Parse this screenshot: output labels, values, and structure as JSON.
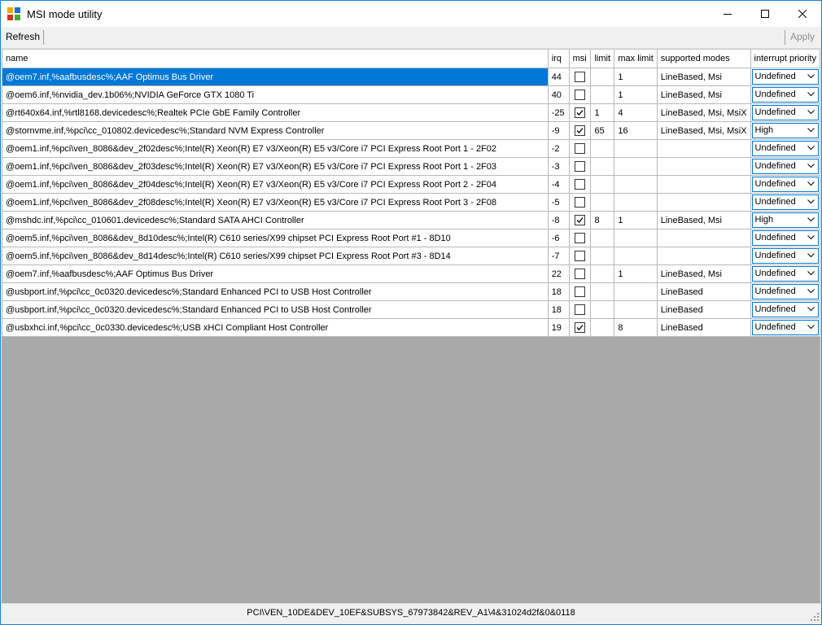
{
  "window": {
    "title": "MSI mode utility"
  },
  "toolbar": {
    "refresh_label": "Refresh",
    "apply_label": "Apply"
  },
  "columns": [
    "name",
    "irq",
    "msi",
    "limit",
    "max limit",
    "supported modes",
    "interrupt priority"
  ],
  "rows": [
    {
      "name": "@oem7.inf,%aafbusdesc%;AAF Optimus Bus Driver",
      "irq": "44",
      "msi": false,
      "limit": "",
      "max_limit": "1",
      "modes": "LineBased, Msi",
      "priority": "Undefined"
    },
    {
      "name": "@oem6.inf,%nvidia_dev.1b06%;NVIDIA GeForce GTX 1080 Ti",
      "irq": "40",
      "msi": false,
      "limit": "",
      "max_limit": "1",
      "modes": "LineBased, Msi",
      "priority": "Undefined"
    },
    {
      "name": "@rt640x64.inf,%rtl8168.devicedesc%;Realtek PCIe GbE Family Controller",
      "irq": "-25",
      "msi": true,
      "limit": "1",
      "max_limit": "4",
      "modes": "LineBased, Msi, MsiX",
      "priority": "Undefined"
    },
    {
      "name": "@stornvme.inf,%pci\\cc_010802.devicedesc%;Standard NVM Express Controller",
      "irq": "-9",
      "msi": true,
      "limit": "65",
      "max_limit": "16",
      "modes": "LineBased, Msi, MsiX",
      "priority": "High"
    },
    {
      "name": "@oem1.inf,%pci\\ven_8086&dev_2f02desc%;Intel(R) Xeon(R) E7 v3/Xeon(R) E5 v3/Core i7 PCI Express Root Port 1 - 2F02",
      "irq": "-2",
      "msi": false,
      "limit": "",
      "max_limit": "",
      "modes": "",
      "priority": "Undefined"
    },
    {
      "name": "@oem1.inf,%pci\\ven_8086&dev_2f03desc%;Intel(R) Xeon(R) E7 v3/Xeon(R) E5 v3/Core i7 PCI Express Root Port 1 - 2F03",
      "irq": "-3",
      "msi": false,
      "limit": "",
      "max_limit": "",
      "modes": "",
      "priority": "Undefined"
    },
    {
      "name": "@oem1.inf,%pci\\ven_8086&dev_2f04desc%;Intel(R) Xeon(R) E7 v3/Xeon(R) E5 v3/Core i7 PCI Express Root Port 2 - 2F04",
      "irq": "-4",
      "msi": false,
      "limit": "",
      "max_limit": "",
      "modes": "",
      "priority": "Undefined"
    },
    {
      "name": "@oem1.inf,%pci\\ven_8086&dev_2f08desc%;Intel(R) Xeon(R) E7 v3/Xeon(R) E5 v3/Core i7 PCI Express Root Port 3 - 2F08",
      "irq": "-5",
      "msi": false,
      "limit": "",
      "max_limit": "",
      "modes": "",
      "priority": "Undefined"
    },
    {
      "name": "@mshdc.inf,%pci\\cc_010601.devicedesc%;Standard SATA AHCI Controller",
      "irq": "-8",
      "msi": true,
      "limit": "8",
      "max_limit": "1",
      "modes": "LineBased, Msi",
      "priority": "High"
    },
    {
      "name": "@oem5.inf,%pci\\ven_8086&dev_8d10desc%;Intel(R) C610 series/X99 chipset PCI Express Root Port #1 - 8D10",
      "irq": "-6",
      "msi": false,
      "limit": "",
      "max_limit": "",
      "modes": "",
      "priority": "Undefined"
    },
    {
      "name": "@oem5.inf,%pci\\ven_8086&dev_8d14desc%;Intel(R) C610 series/X99 chipset PCI Express Root Port #3 - 8D14",
      "irq": "-7",
      "msi": false,
      "limit": "",
      "max_limit": "",
      "modes": "",
      "priority": "Undefined"
    },
    {
      "name": "@oem7.inf,%aafbusdesc%;AAF Optimus Bus Driver",
      "irq": "22",
      "msi": false,
      "limit": "",
      "max_limit": "1",
      "modes": "LineBased, Msi",
      "priority": "Undefined"
    },
    {
      "name": "@usbport.inf,%pci\\cc_0c0320.devicedesc%;Standard Enhanced PCI to USB Host Controller",
      "irq": "18",
      "msi": false,
      "limit": "",
      "max_limit": "",
      "modes": "LineBased",
      "priority": "Undefined"
    },
    {
      "name": "@usbport.inf,%pci\\cc_0c0320.devicedesc%;Standard Enhanced PCI to USB Host Controller",
      "irq": "18",
      "msi": false,
      "limit": "",
      "max_limit": "",
      "modes": "LineBased",
      "priority": "Undefined"
    },
    {
      "name": "@usbxhci.inf,%pci\\cc_0c0330.devicedesc%;USB xHCI Compliant Host Controller",
      "irq": "19",
      "msi": true,
      "limit": "",
      "max_limit": "8",
      "modes": "LineBased",
      "priority": "Undefined"
    }
  ],
  "status": {
    "text": "PCI\\VEN_10DE&DEV_10EF&SUBSYS_67973842&REV_A1\\4&31024d2f&0&0118"
  },
  "colors": {
    "selection": "#0078d7",
    "empty_area": "#a9a9a9"
  }
}
